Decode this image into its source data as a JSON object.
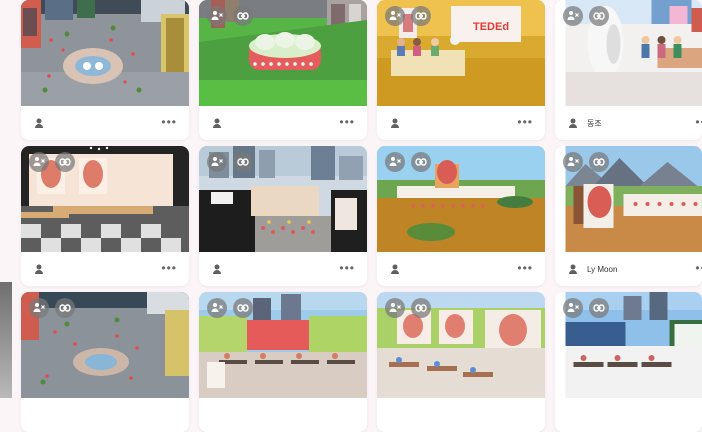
{
  "cards": [
    {
      "id": "r1c1",
      "owner": "",
      "theme": "city-top",
      "badges": []
    },
    {
      "id": "r1c2",
      "owner": "",
      "theme": "green-zoo",
      "badges": [
        "user-x",
        "link"
      ]
    },
    {
      "id": "r1c3",
      "owner": "",
      "theme": "ted-stage",
      "badges": [
        "user-x",
        "link"
      ],
      "sign_text": "TEDEd"
    },
    {
      "id": "r1c4",
      "owner": "동조",
      "theme": "white-room",
      "badges": [
        "user-x",
        "link"
      ]
    },
    {
      "id": "r2c1",
      "owner": "",
      "theme": "anatomy-room",
      "badges": [
        "user-x",
        "link"
      ]
    },
    {
      "id": "r2c2",
      "owner": "",
      "theme": "city-stage",
      "badges": [
        "user-x",
        "link"
      ]
    },
    {
      "id": "r2c3",
      "owner": "",
      "theme": "desert-stage",
      "badges": [
        "user-x",
        "link"
      ]
    },
    {
      "id": "r2c4",
      "owner": "Ly Moon",
      "theme": "mountain-gallery",
      "badges": [
        "user-x",
        "link"
      ]
    },
    {
      "id": "r3c1",
      "owner": "",
      "theme": "city-top-2",
      "badges": [
        "user-x",
        "link"
      ]
    },
    {
      "id": "r3c2",
      "owner": "",
      "theme": "classroom-green",
      "badges": [
        "user-x",
        "link"
      ]
    },
    {
      "id": "r3c3",
      "owner": "",
      "theme": "classroom-anatomy",
      "badges": [
        "user-x",
        "link"
      ]
    },
    {
      "id": "r3c4",
      "owner": "",
      "theme": "outdoor-board",
      "badges": [
        "user-x",
        "link"
      ]
    }
  ],
  "icons": {
    "owner": "person-icon",
    "menu": "more-horizontal-icon",
    "private": "user-x-icon",
    "link": "link-icon"
  },
  "menu_text": "•••"
}
